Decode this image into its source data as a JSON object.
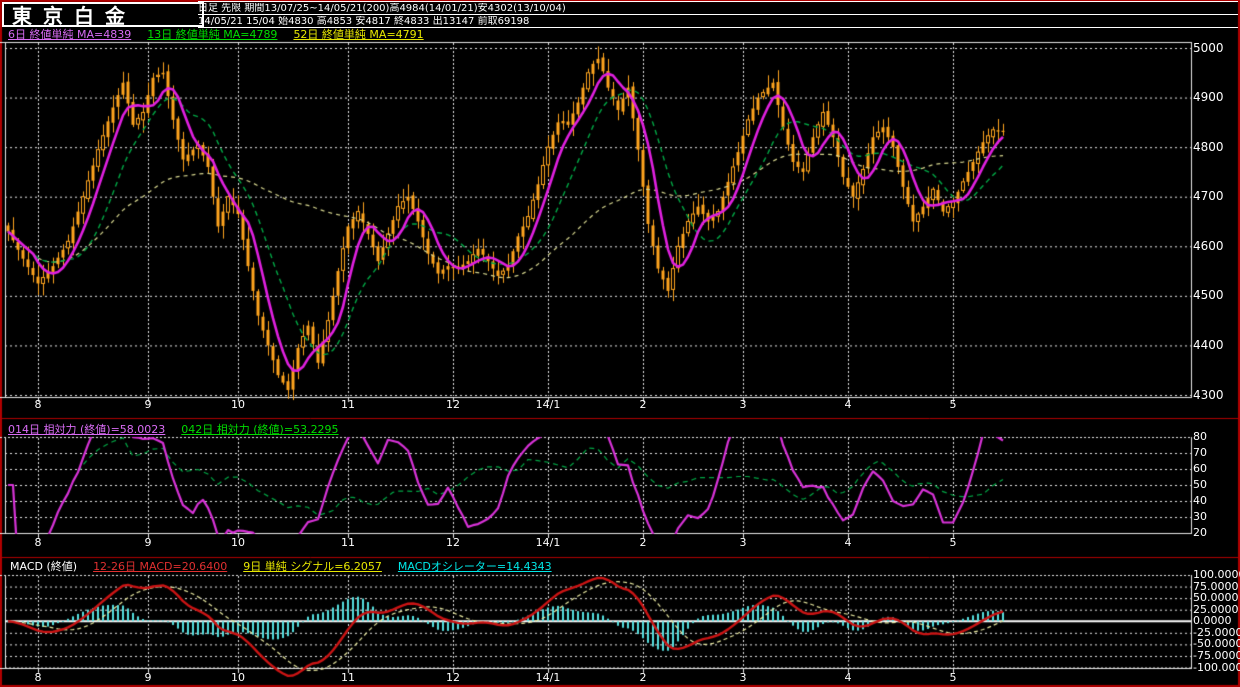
{
  "header": {
    "title": "東京白金",
    "info_line1": "日足 先限  期間13/07/25~14/05/21(200)高4984(14/01/21)安4302(13/10/04)",
    "info_line2": "14/05/21 15/04 始4830 高4853 安4817 終4833 出13147 前取69198"
  },
  "legend": {
    "ma6": "6日 終値単純 MA=4839",
    "ma13": "13日 終値単純 MA=4789",
    "ma52": "52日 終値単純 MA=4791"
  },
  "rsi_header": {
    "rsi14": "014日 相対力 (終値)=58.0023",
    "rsi42": "042日 相対力 (終値)=53.2295"
  },
  "macd_header": {
    "label": "MACD (終値)",
    "macd": "12-26日 MACD=20.6400",
    "signal": "9日 単純 シグナル=6.2057",
    "osc": "MACDオシレーター=14.4343"
  },
  "colors": {
    "background": "#000000",
    "frame_red": "#b00000",
    "grid_white": "#e8e8e8",
    "candle": "#ffa51e",
    "ma6": "#e020e0",
    "ma13": "#00a845",
    "ma52": "#d8d890",
    "rsi14": "#d832d8",
    "rsi42": "#00a845",
    "macd_line": "#cc1414",
    "macd_signal": "#e8e8a0",
    "macd_osc": "#55dede",
    "text_white": "#ffffff",
    "legend_ma6": "#d96cf5",
    "legend_ma13": "#00dd00",
    "legend_ma52": "#e8e800",
    "legend_macd_red": "#e03030",
    "legend_signal_yellow": "#e8e800",
    "legend_osc_cyan": "#00e8e8"
  },
  "chart_data": {
    "type": "candlestick",
    "title": "東京白金 日足 先限",
    "bars": 200,
    "months": {
      "labels": [
        "8",
        "9",
        "10",
        "11",
        "12",
        "14/1",
        "2",
        "3",
        "4",
        "5"
      ],
      "indices": [
        6,
        28,
        46,
        68,
        89,
        108,
        127,
        147,
        168,
        189
      ]
    },
    "main": {
      "ylim": [
        4300,
        5000
      ],
      "yticks": [
        5000,
        4900,
        4800,
        4700,
        4600,
        4500,
        4400,
        4300
      ],
      "overlays": [
        {
          "name": "MA6",
          "period": 6,
          "style": "solid magenta"
        },
        {
          "name": "MA13",
          "period": 13,
          "style": "dashed green"
        },
        {
          "name": "MA52",
          "period": 52,
          "style": "dashed khaki"
        }
      ],
      "close": [
        4630,
        4612,
        4593,
        4575,
        4558,
        4542,
        4525,
        4537,
        4548,
        4560,
        4577,
        4593,
        4610,
        4640,
        4670,
        4700,
        4732,
        4763,
        4795,
        4823,
        4852,
        4880,
        4905,
        4930,
        4888,
        4845,
        4858,
        4870,
        4905,
        4940,
        4945,
        4950,
        4903,
        4855,
        4815,
        4775,
        4785,
        4795,
        4805,
        4783,
        4760,
        4700,
        4640,
        4670,
        4700,
        4683,
        4665,
        4613,
        4560,
        4510,
        4460,
        4430,
        4400,
        4370,
        4340,
        4325,
        4310,
        4353,
        4395,
        4418,
        4440,
        4403,
        4365,
        4408,
        4450,
        4500,
        4550,
        4595,
        4640,
        4655,
        4670,
        4648,
        4625,
        4598,
        4570,
        4598,
        4625,
        4653,
        4680,
        4690,
        4700,
        4675,
        4650,
        4618,
        4585,
        4565,
        4545,
        4553,
        4560,
        4558,
        4555,
        4563,
        4570,
        4583,
        4595,
        4583,
        4570,
        4555,
        4540,
        4550,
        4560,
        4590,
        4620,
        4640,
        4660,
        4693,
        4725,
        4763,
        4800,
        4825,
        4850,
        4848,
        4845,
        4868,
        4890,
        4920,
        4950,
        4968,
        4978,
        4953,
        4920,
        4898,
        4875,
        4898,
        4920,
        4858,
        4795,
        4720,
        4645,
        4600,
        4555,
        4533,
        4510,
        4555,
        4600,
        4625,
        4650,
        4665,
        4680,
        4665,
        4650,
        4660,
        4670,
        4700,
        4730,
        4760,
        4790,
        4823,
        4855,
        4878,
        4900,
        4910,
        4920,
        4930,
        4885,
        4840,
        4805,
        4770,
        4760,
        4750,
        4785,
        4820,
        4845,
        4870,
        4845,
        4820,
        4780,
        4740,
        4720,
        4700,
        4728,
        4755,
        4788,
        4820,
        4830,
        4840,
        4820,
        4800,
        4760,
        4720,
        4685,
        4650,
        4665,
        4680,
        4698,
        4715,
        4693,
        4670,
        4680,
        4690,
        4710,
        4730,
        4750,
        4770,
        4790,
        4810,
        4823,
        4835,
        4834,
        4833
      ]
    },
    "rsi": {
      "ylim": [
        20,
        80
      ],
      "yticks": [
        80,
        70,
        60,
        50,
        40,
        30,
        20
      ],
      "periods": [
        14,
        42
      ],
      "last_values": [
        58.0023,
        53.2295
      ]
    },
    "macd": {
      "ylim": [
        -100,
        100
      ],
      "ytick_labels": [
        "100.0000",
        "75.0000",
        "50.0000",
        "25.0000",
        "0.0000",
        "-25.0000",
        "-50.0000",
        "-75.0000",
        "-100.000"
      ],
      "ytick_values": [
        100,
        75,
        50,
        25,
        0,
        -25,
        -50,
        -75,
        -100
      ],
      "fast": 12,
      "slow": 26,
      "signal_period": 9,
      "last_values": {
        "macd": 20.64,
        "signal": 6.2057,
        "oscillator": 14.4343
      }
    }
  }
}
